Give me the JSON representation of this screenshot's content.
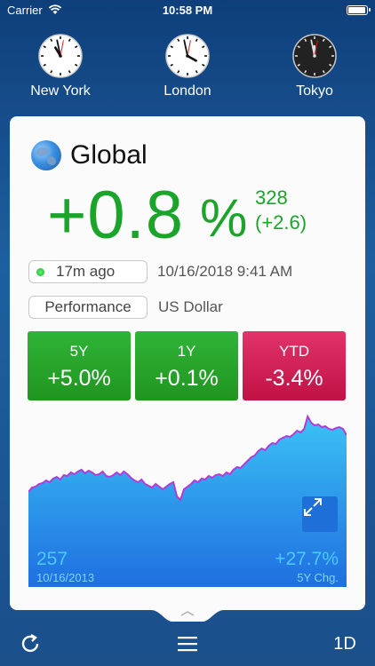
{
  "status": {
    "carrier": "Carrier",
    "time": "10:58 PM",
    "battery_level": 1.0
  },
  "clocks": [
    {
      "city": "New York",
      "dark": false
    },
    {
      "city": "London",
      "dark": false
    },
    {
      "city": "Tokyo",
      "dark": true
    }
  ],
  "card": {
    "title": "Global",
    "change_value": "+0.8",
    "change_unit": "%",
    "points": "328",
    "points_change": "(+2.6)",
    "updated": "17m ago",
    "timestamp": "10/16/2018 9:41 AM",
    "mode": "Performance",
    "currency": "US Dollar"
  },
  "periods": [
    {
      "label": "5Y",
      "value": "+5.0%",
      "color": "green"
    },
    {
      "label": "1Y",
      "value": "+0.1%",
      "color": "green"
    },
    {
      "label": "YTD",
      "value": "-3.4%",
      "color": "red"
    }
  ],
  "chart": {
    "start_value": "257",
    "start_date": "10/16/2013",
    "change": "+27.7%",
    "change_label": "5Y Chg."
  },
  "chart_data": {
    "type": "area",
    "series": [
      {
        "values": [
          257,
          262,
          263,
          266,
          267,
          270,
          268,
          272,
          274,
          271,
          276,
          275,
          279,
          277,
          280,
          282,
          278,
          281,
          279,
          276,
          277,
          280,
          275,
          274,
          276,
          279,
          276,
          280,
          277,
          273,
          270,
          268,
          271,
          266,
          264,
          262,
          266,
          263,
          260,
          263,
          266,
          268,
          252,
          248,
          260,
          263,
          266,
          270,
          268,
          272,
          271,
          275,
          273,
          276,
          277,
          275,
          279,
          277,
          282,
          285,
          284,
          288,
          292,
          296,
          298,
          303,
          306,
          304,
          309,
          312,
          311,
          316,
          318,
          320,
          319,
          322,
          326,
          324,
          328,
          342,
          335,
          332,
          333,
          330,
          331,
          328,
          327,
          329,
          330,
          328,
          321
        ]
      }
    ],
    "ylim": [
      150,
      350
    ]
  },
  "toolbar": {
    "refresh_icon": "refresh-icon",
    "menu_icon": "menu-icon",
    "range_label": "1D"
  },
  "colors": {
    "green": "#1aa52a",
    "red": "#c01245",
    "chart_top": "#3bc2f5",
    "chart_bottom": "#1f6fe0",
    "line": "#b33bd6"
  }
}
